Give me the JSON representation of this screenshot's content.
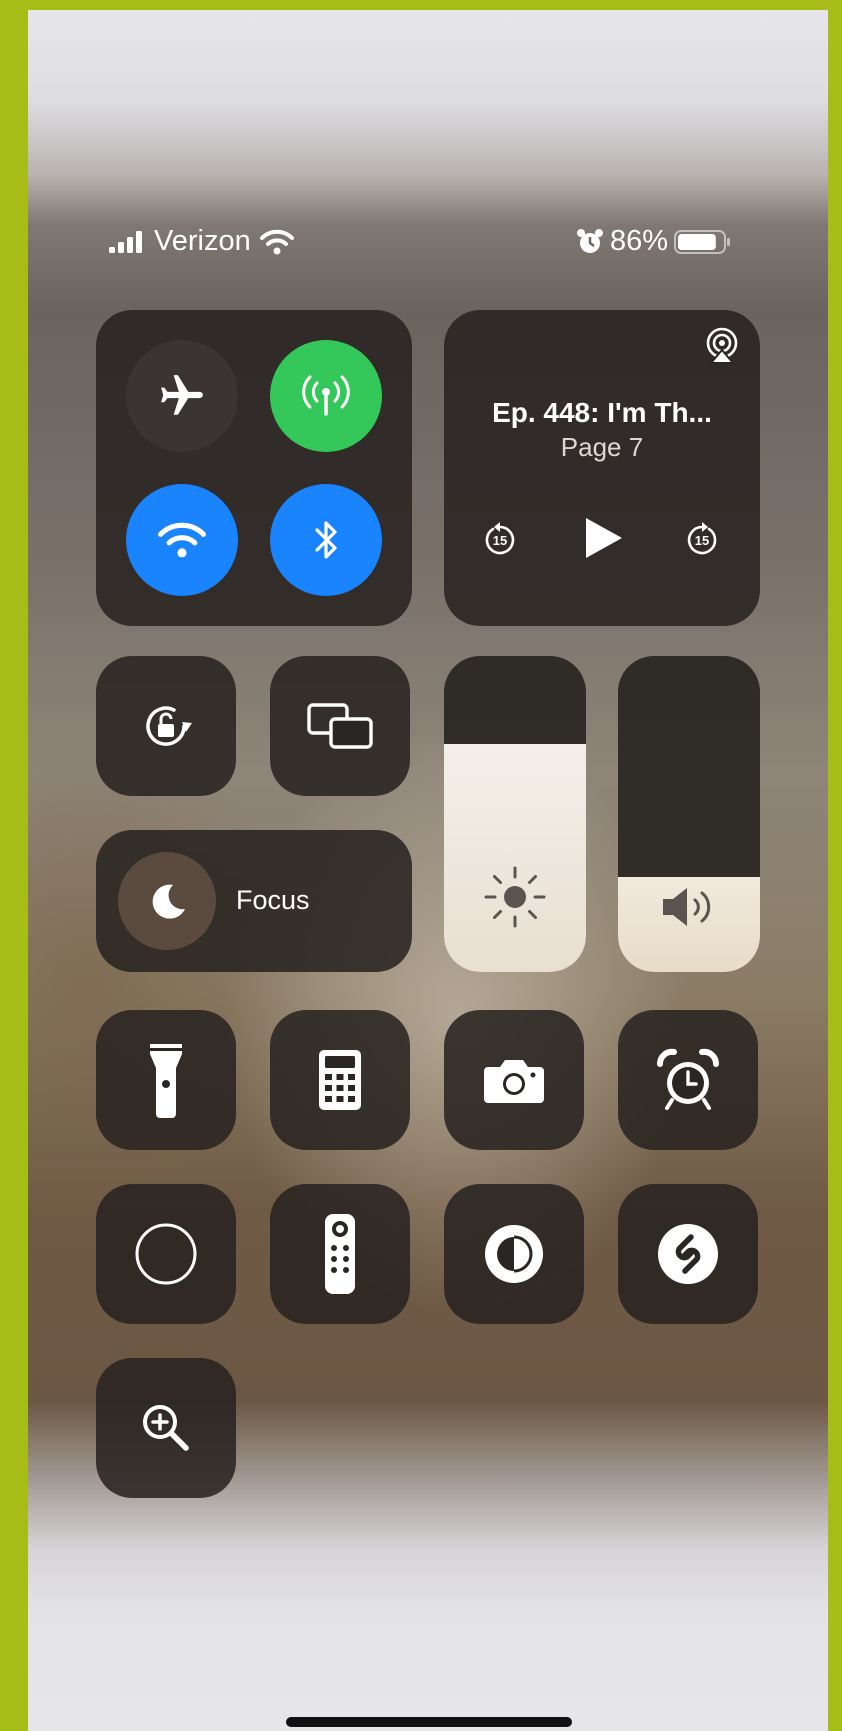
{
  "status_bar": {
    "carrier": "Verizon",
    "battery_percent": "86%",
    "battery_level": 0.86,
    "icons": [
      "signal-bars-icon",
      "wifi-icon",
      "alarm-icon",
      "battery-icon"
    ]
  },
  "connectivity": {
    "airplane_mode": false,
    "cellular_data": true,
    "wifi": true,
    "bluetooth": true,
    "colors": {
      "off": "#3a3532",
      "cellular_on": "#34c759",
      "wifi_on": "#1a84ff",
      "bluetooth_on": "#1a84ff"
    }
  },
  "now_playing": {
    "title": "Ep. 448: I'm Th...",
    "subtitle": "Page 7",
    "skip_back_seconds": "15",
    "skip_forward_seconds": "15"
  },
  "focus": {
    "label": "Focus"
  },
  "brightness": {
    "level": 0.72
  },
  "volume": {
    "level": 0.3
  },
  "controls": [
    "screen-rotation-lock",
    "screen-mirroring",
    "flashlight",
    "calculator",
    "camera",
    "alarm",
    "screen-recording",
    "apple-tv-remote",
    "dark-mode",
    "shazam",
    "magnifier"
  ]
}
